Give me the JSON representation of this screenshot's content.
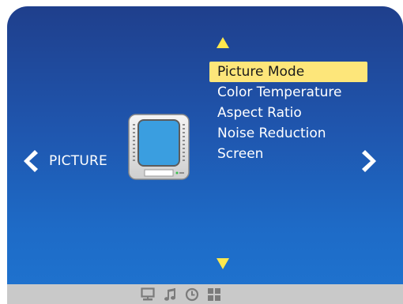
{
  "osd": {
    "category": "PICTURE",
    "menu": {
      "items": [
        {
          "label": "Picture Mode",
          "selected": true
        },
        {
          "label": "Color Temperature",
          "selected": false
        },
        {
          "label": "Aspect Ratio",
          "selected": false
        },
        {
          "label": "Noise Reduction",
          "selected": false
        },
        {
          "label": "Screen",
          "selected": false
        }
      ]
    },
    "bottom_tabs": [
      "monitor-icon",
      "music-note-icon",
      "clock-icon",
      "grid-icon"
    ]
  },
  "colors": {
    "background_top": "#1f3f8c",
    "background_bottom": "#1f74d0",
    "highlight": "#fde67a",
    "arrow_yellow": "#ffe84d",
    "bottom_bar": "#c9c9c9",
    "icon_gray": "#7b7b7b"
  }
}
